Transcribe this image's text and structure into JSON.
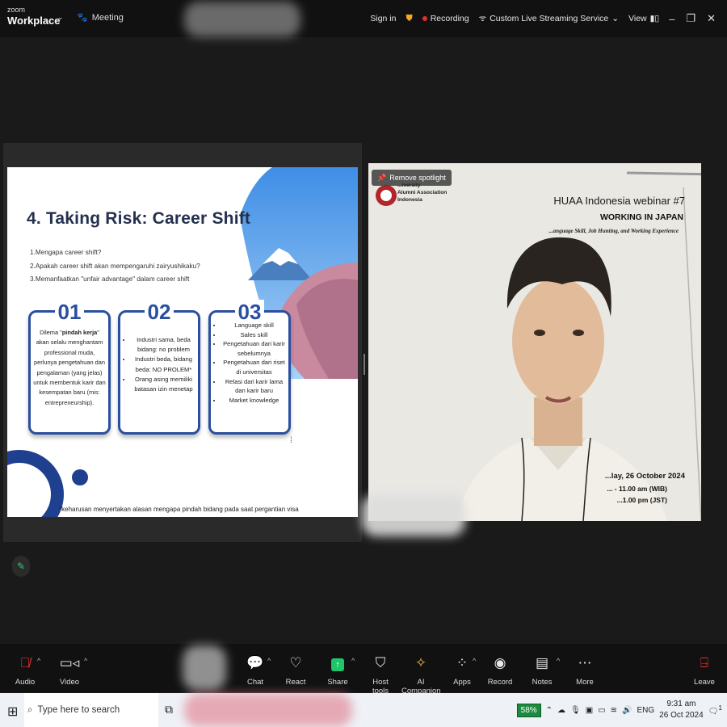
{
  "app": {
    "logo_top": "zoom",
    "logo_bottom": "Workplace",
    "meeting_label": "Meeting",
    "sign_in": "Sign in",
    "recording": "Recording",
    "streaming": "Custom Live Streaming Service",
    "view": "View"
  },
  "slide": {
    "title": "4. Taking Risk: Career Shift",
    "questions": [
      "1.Mengapa career shift?",
      "2.Apakah career shift akan mempengaruhi zairyushikaku?",
      "3.Memanfaatkan \"unfair advantage\" dalam career shift"
    ],
    "cards": [
      {
        "num": "01",
        "text_before": "Dilema \"",
        "text_bold": "pindah kerja",
        "text_after": "\" akan selalu menghantam professional muda, perlunya pengetahuan dan pengalaman (yang jelas) untuk membentuk karir dan kesempatan baru (mis: entrepreneurship)."
      },
      {
        "num": "02",
        "items": [
          "Industri sama, beda bidang: no problem",
          "Industri beda, bidang beda: NO PROLEM*",
          "Orang asing memiliki batasan izin menetap"
        ]
      },
      {
        "num": "03",
        "items": [
          "Language skill",
          "Sales skill",
          "Pengetahuan dari karir sebelumnya",
          "Pengetahuan dari riset di universitas",
          "Relasi dari karir lama dan karir baru",
          "Market knowledge"
        ]
      }
    ],
    "footnote": "*keharusan menyertakan alasan mengapa pindah bidang pada saat pergantian visa"
  },
  "speaker": {
    "remove_spotlight": "Remove spotlight",
    "org_line1": "...iversity",
    "org_line2": "Alumni Association",
    "org_line3": "Indonesia",
    "webinar_title": "HUAA Indonesia webinar #7",
    "webinar_sub": "WORKING IN JAPAN",
    "webinar_tag": "...anguage Skill, Job Hunting, and Working Experience",
    "date": "...lay, 26 October 2024",
    "time1": "... - 11.00 am (WIB)",
    "time2": "...1.00 pm (JST)"
  },
  "toolbar": {
    "items": [
      "Audio",
      "Video",
      "Chat",
      "React",
      "Share",
      "Host tools",
      "AI Companion",
      "Apps",
      "Record",
      "Notes",
      "More",
      "Leave"
    ]
  },
  "taskbar": {
    "search_placeholder": "Type here to search",
    "battery": "58%",
    "lang": "ENG",
    "time": "9:31 am",
    "date": "26 Oct 2024",
    "notif": "1"
  },
  "colors": {
    "accent_blue": "#2a4fa0",
    "share_green": "#1fc46b",
    "record_red": "#e0312e",
    "leave_red": "#e0312e"
  }
}
